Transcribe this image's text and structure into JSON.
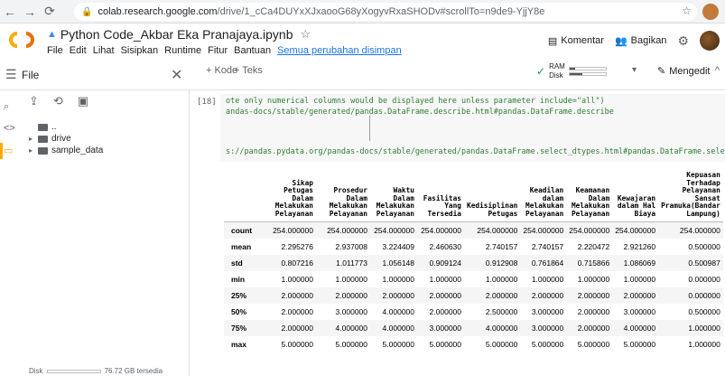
{
  "browser": {
    "url_domain": "colab.research.google.com",
    "url_path": "/drive/1_cCa4DUYxXJxaooG68yXogyvRxaSHODv#scrollTo=n9de9-YjjY8e"
  },
  "notebook": {
    "title": "Python Code_Akbar Eka Pranajaya.ipynb",
    "menu": [
      "File",
      "Edit",
      "Lihat",
      "Sisipkan",
      "Runtime",
      "Fitur",
      "Bantuan"
    ],
    "saved_status": "Semua perubahan disimpan",
    "comment_label": "Komentar",
    "share_label": "Bagikan"
  },
  "toolbar": {
    "add_code": "+ Kode",
    "add_text": "+ Teks",
    "ram_label": "RAM",
    "disk_label": "Disk",
    "ram_usage": 0.15,
    "disk_usage": 0.35,
    "editing_label": "Mengedit"
  },
  "files": {
    "title": "File",
    "items": [
      {
        "name": ".."
      },
      {
        "name": "drive"
      },
      {
        "name": "sample_data"
      }
    ],
    "footer": "Disk",
    "footer_value": "76.72 GB tersedia"
  },
  "cell": {
    "number": "[18]",
    "lines": [
      "ote only numerical columns would be displayed here unless parameter include=\"all\")",
      "andas-docs/stable/generated/pandas.DataFrame.describe.html#pandas.DataFrame.describe",
      "",
      "",
      "s://pandas.pydata.org/pandas-docs/stable/generated/pandas.DataFrame.select_dtypes.html#pandas.DataFrame.select_dtypes"
    ]
  },
  "table": {
    "columns": [
      [
        "Sikap Petugas",
        "Dalam",
        "Melakukan",
        "Pelayanan"
      ],
      [
        "Prosedur",
        "Dalam",
        "Melakukan",
        "Pelayanan"
      ],
      [
        "Waktu",
        "Dalam",
        "Melakukan",
        "Pelayanan"
      ],
      [
        "Fasilitas",
        "Yang",
        "Tersedia"
      ],
      [
        "Kedisiplinan",
        "Petugas"
      ],
      [
        "Keadilan",
        "dalam",
        "Melakukan",
        "Pelayanan"
      ],
      [
        "Keamanan",
        "Dalam",
        "Melakukan",
        "Pelayanan"
      ],
      [
        "Kewajaran",
        "dalam Hal",
        "Biaya"
      ],
      [
        "Kepuasan",
        "Terhadap",
        "Pelayanan",
        "Sansat",
        "Pramuka(Bandar",
        "Lampung)"
      ]
    ],
    "rows": [
      {
        "label": "count",
        "values": [
          "254.000000",
          "254.000000",
          "254.000000",
          "254.000000",
          "254.000000",
          "254.000000",
          "254.000000",
          "254.000000",
          "254.000000"
        ]
      },
      {
        "label": "mean",
        "values": [
          "2.295276",
          "2.937008",
          "3.224409",
          "2.460630",
          "2.740157",
          "2.740157",
          "2.220472",
          "2.921260",
          "0.500000"
        ]
      },
      {
        "label": "std",
        "values": [
          "0.807216",
          "1.011773",
          "1.056148",
          "0.909124",
          "0.912908",
          "0.761864",
          "0.715866",
          "1.086069",
          "0.500987"
        ]
      },
      {
        "label": "min",
        "values": [
          "1.000000",
          "1.000000",
          "1.000000",
          "1.000000",
          "1.000000",
          "1.000000",
          "1.000000",
          "1.000000",
          "0.000000"
        ]
      },
      {
        "label": "25%",
        "values": [
          "2.000000",
          "2.000000",
          "2.000000",
          "2.000000",
          "2.000000",
          "2.000000",
          "2.000000",
          "2.000000",
          "0.000000"
        ]
      },
      {
        "label": "50%",
        "values": [
          "2.000000",
          "3.000000",
          "4.000000",
          "2.000000",
          "2.500000",
          "3.000000",
          "2.000000",
          "3.000000",
          "0.500000"
        ]
      },
      {
        "label": "75%",
        "values": [
          "2.000000",
          "4.000000",
          "4.000000",
          "3.000000",
          "4.000000",
          "3.000000",
          "2.000000",
          "4.000000",
          "1.000000"
        ]
      },
      {
        "label": "max",
        "values": [
          "5.000000",
          "5.000000",
          "5.000000",
          "5.000000",
          "5.000000",
          "5.000000",
          "5.000000",
          "5.000000",
          "1.000000"
        ]
      }
    ]
  },
  "colors": {
    "accent": "#1a73e8",
    "output_text": "#2e7d32",
    "active_tab": "#f9ab00"
  },
  "icons": {
    "back": "back-arrow-icon",
    "forward": "forward-arrow-icon",
    "reload": "reload-icon",
    "lock": "lock-icon"
  }
}
